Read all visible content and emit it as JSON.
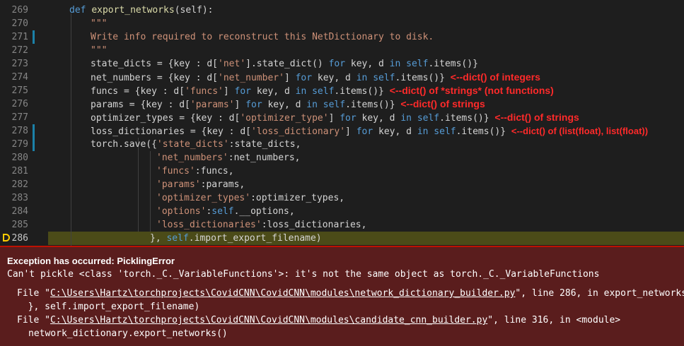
{
  "editor": {
    "lines": [
      {
        "num": "269"
      },
      {
        "num": "270"
      },
      {
        "num": "271"
      },
      {
        "num": "272"
      },
      {
        "num": "273"
      },
      {
        "num": "274"
      },
      {
        "num": "275"
      },
      {
        "num": "276"
      },
      {
        "num": "277"
      },
      {
        "num": "278"
      },
      {
        "num": "279"
      },
      {
        "num": "280"
      },
      {
        "num": "281"
      },
      {
        "num": "282"
      },
      {
        "num": "283"
      },
      {
        "num": "284"
      },
      {
        "num": "285"
      },
      {
        "num": "286"
      }
    ],
    "code": {
      "l269": {
        "kw": "def",
        "fn": "export_networks",
        "rest": "(self):"
      },
      "l270": {
        "doc": "\"\"\""
      },
      "l271": {
        "doc": "Write info required to reconstruct this NetDictionary to disk."
      },
      "l272": {
        "doc": "\"\"\""
      },
      "l273": {
        "a": "state_dicts = {key : d[",
        "s": "'net'",
        "b": "].state_dict() ",
        "for": "for",
        "c": " key, d ",
        "in": "in",
        "d": " ",
        "self": "self",
        "e": ".items()}"
      },
      "l274": {
        "a": "net_numbers = {key : d[",
        "s": "'net_number'",
        "b": "] ",
        "for": "for",
        "c": " key, d ",
        "in": "in",
        "d": " ",
        "self": "self",
        "e": ".items()}",
        "ann": "<--dict() of integers"
      },
      "l275": {
        "a": "funcs = {key : d[",
        "s": "'funcs'",
        "b": "] ",
        "for": "for",
        "c": " key, d ",
        "in": "in",
        "d": " ",
        "self": "self",
        "e": ".items()}",
        "ann": "<--dict() of *strings* (not functions)"
      },
      "l276": {
        "a": "params = {key : d[",
        "s": "'params'",
        "b": "] ",
        "for": "for",
        "c": " key, d ",
        "in": "in",
        "d": " ",
        "self": "self",
        "e": ".items()}",
        "ann": "<--dict() of strings"
      },
      "l277": {
        "a": "optimizer_types = {key : d[",
        "s": "'optimizer_type'",
        "b": "] ",
        "for": "for",
        "c": " key, d ",
        "in": "in",
        "d": " ",
        "self": "self",
        "e": ".items()}",
        "ann": "<--dict() of strings"
      },
      "l278": {
        "a": "loss_dictionaries = {key : d[",
        "s": "'loss_dictionary'",
        "b": "] ",
        "for": "for",
        "c": " key, d ",
        "in": "in",
        "d": " ",
        "self": "self",
        "e": ".items()}",
        "ann": "<--dict() of (list(float), list(float))"
      },
      "l279": {
        "a": "torch.save({",
        "s": "'state_dicts'",
        "b": ":state_dicts,"
      },
      "l280": {
        "s": "'net_numbers'",
        "b": ":net_numbers,"
      },
      "l281": {
        "s": "'funcs'",
        "b": ":funcs,"
      },
      "l282": {
        "s": "'params'",
        "b": ":params,"
      },
      "l283": {
        "s": "'optimizer_types'",
        "b": ":optimizer_types,"
      },
      "l284": {
        "s": "'options'",
        "b": ":",
        "self": "self",
        "c": ".__options,"
      },
      "l285": {
        "s": "'loss_dictionaries'",
        "b": ":loss_dictionaries,"
      },
      "l286": {
        "a": "}, ",
        "self": "self",
        "b": ".import_export_filename)"
      }
    }
  },
  "exception": {
    "title": "Exception has occurred: PicklingError",
    "message": "Can't pickle <class 'torch._C._VariableFunctions'>: it's not the same object as torch._C._VariableFunctions",
    "frames": [
      {
        "pre": "File \"",
        "path": "C:\\Users\\Hartz\\torchprojects\\CovidCNN\\CovidCNN\\modules\\network_dictionary_builder.py",
        "post": "\", line 286, in export_networks",
        "code": "  }, self.import_export_filename)"
      },
      {
        "pre": "File \"",
        "path": "C:\\Users\\Hartz\\torchprojects\\CovidCNN\\CovidCNN\\modules\\candidate_cnn_builder.py",
        "post": "\", line 316, in <module>",
        "code": "network_dictionary.export_networks()"
      }
    ]
  },
  "colors": {
    "background": "#1e1e1e",
    "keyword": "#569cd6",
    "string": "#ce9178",
    "function": "#dcdcaa",
    "annotation": "#ff2a2a",
    "exception_bg": "#5a1d1d",
    "current_line": "#4b4b18"
  }
}
